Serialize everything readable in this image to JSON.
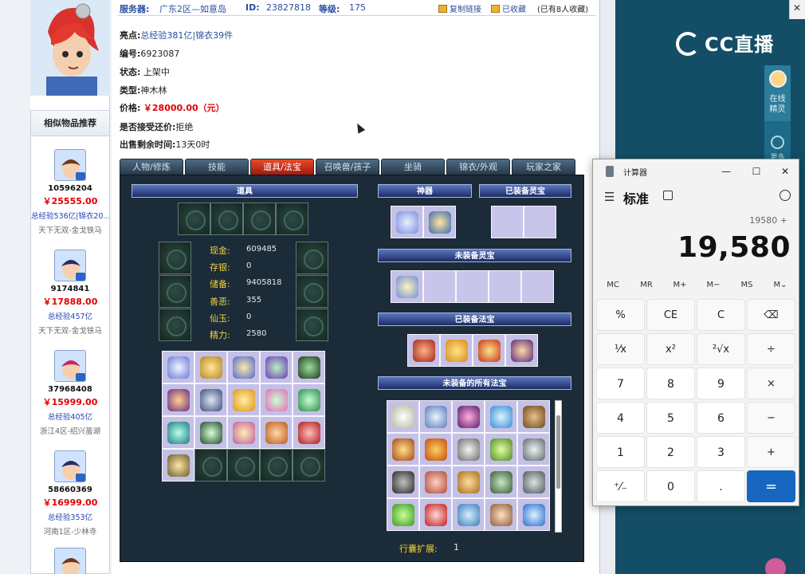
{
  "topbar": {
    "server_label": "服务器:",
    "server_value": "广东2区—如意岛",
    "id_label": "ID:",
    "id_value": "23827818",
    "level_label": "等级:",
    "level_value": "175",
    "copy_link": "复制链接",
    "favorited": "已收藏",
    "fav_count": "(已有8人收藏)"
  },
  "info": {
    "highlight_label": "亮点:",
    "highlight_value": "总经验381亿|锦衣39件",
    "number_label": "编号:",
    "number_value": "6923087",
    "status_label": "状态:",
    "status_value": "上架中",
    "type_label": "类型:",
    "type_value": "神木林",
    "price_label": "价格:",
    "price_value": "￥28000.00（元）",
    "counter_label": "是否接受还价:",
    "counter_value": "拒绝",
    "remaining_label": "出售剩余时间:",
    "remaining_value": "13天0时"
  },
  "tabs": [
    {
      "label": "人物/修炼"
    },
    {
      "label": "技能"
    },
    {
      "label": "道具/法宝"
    },
    {
      "label": "召唤兽/孩子"
    },
    {
      "label": "坐骑"
    },
    {
      "label": "锦衣/外观"
    },
    {
      "label": "玩家之家"
    }
  ],
  "active_tab": "道具/法宝",
  "game_panel": {
    "items_header": "道具",
    "artifact_header": "神器",
    "equipped_spirit_header": "已装备灵宝",
    "unequipped_spirit_header": "未装备灵宝",
    "equipped_treasure_header": "已装备法宝",
    "unequipped_treasure_header": "未装备的所有法宝",
    "stats": [
      {
        "label": "现金:",
        "value": "609485"
      },
      {
        "label": "存银:",
        "value": "0"
      },
      {
        "label": "储备:",
        "value": "9405818"
      },
      {
        "label": "善恶:",
        "value": "355"
      },
      {
        "label": "仙玉:",
        "value": "0"
      },
      {
        "label": "精力:",
        "value": "2580"
      }
    ],
    "bag_expand_label": "行囊扩展:",
    "bag_expand_value": "1"
  },
  "recommend": {
    "title": "相似物品推荐",
    "items": [
      {
        "id": "10596204",
        "price": "￥25555.00",
        "tag": "总经验536亿|锦衣20...",
        "server": "天下无双-金戈铁马"
      },
      {
        "id": "9174841",
        "price": "￥17888.00",
        "tag": "总经验457亿",
        "server": "天下无双-金戈铁马"
      },
      {
        "id": "37968408",
        "price": "￥15999.00",
        "tag": "总经验405亿",
        "server": "浙江4区-绍兴蜚湖"
      },
      {
        "id": "58660369",
        "price": "￥16999.00",
        "tag": "总经验353亿",
        "server": "河南1区-少林寺"
      }
    ]
  },
  "cc": {
    "logo": "CC直播",
    "sprite_label": "在线精灵",
    "more_label": "更多"
  },
  "calculator": {
    "title": "计算器",
    "mode": "标准",
    "expression": "19580 +",
    "display": "19,580",
    "memory": [
      "MC",
      "MR",
      "M+",
      "M−",
      "MS",
      "M⌄"
    ],
    "keys": [
      [
        "%",
        "CE",
        "C",
        "⌫"
      ],
      [
        "¹⁄x",
        "x²",
        "²√x",
        "÷"
      ],
      [
        "7",
        "8",
        "9",
        "×"
      ],
      [
        "4",
        "5",
        "6",
        "−"
      ],
      [
        "1",
        "2",
        "3",
        "+"
      ],
      [
        "⁺⁄₋",
        "0",
        ".",
        "="
      ]
    ]
  },
  "colors": {
    "price_red": "#e00000",
    "link_blue": "#2b4fa0",
    "tab_active": "#c8321c",
    "calc_accent": "#1767c0",
    "cc_bg": "#134e66"
  }
}
